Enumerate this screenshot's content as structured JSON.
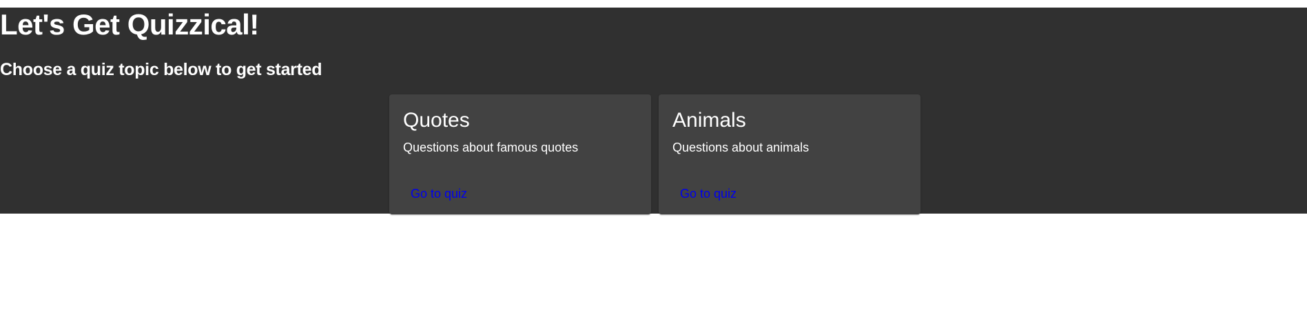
{
  "header": {
    "title": "Let's Get Quizzical!",
    "subtitle": "Choose a quiz topic below to get started"
  },
  "topics": [
    {
      "title": "Quotes",
      "description": "Questions about famous quotes",
      "action_label": "Go to quiz"
    },
    {
      "title": "Animals",
      "description": "Questions about animals",
      "action_label": "Go to quiz"
    }
  ],
  "colors": {
    "hero_background": "#303030",
    "card_background": "#424242",
    "text": "#ffffff",
    "link": "#0000ee"
  }
}
